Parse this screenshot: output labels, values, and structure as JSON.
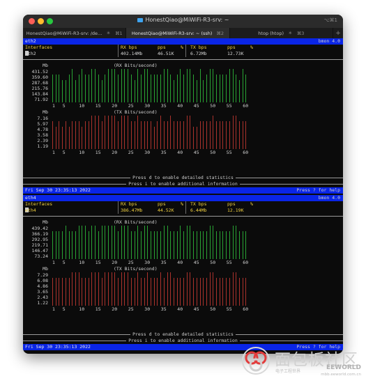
{
  "window": {
    "title": "HonestQiao@MiWiFi-R3-srv: ~",
    "shortcut": "⌥⌘1"
  },
  "tabs": [
    {
      "label": "HonestQiao@MiWiFi-R3-srv: /de...",
      "shortcut": "⌘1",
      "active": false
    },
    {
      "label": "HonestQiao@MiWiFi-R3-srv: ~ (ssh)",
      "shortcut": "⌘2",
      "active": true
    },
    {
      "label": "htop (htop)",
      "shortcut": "⌘3",
      "active": false
    }
  ],
  "new_tab": "+",
  "panes": [
    {
      "iface": "eth2",
      "version": "bmon 4.0",
      "cols": {
        "interfaces": "Interfaces",
        "rx_bps": "RX bps",
        "pps": "pps",
        "pct": "%",
        "tx_bps": "TX bps",
        "tx_pps": "pps",
        "tx_pct": "%"
      },
      "row": {
        "name": "eth2",
        "rx_bps": "402.14Mb",
        "rx_pps": "46.51K",
        "tx_bps": "6.72Mb",
        "tx_pps": "12.73K"
      },
      "row_highlight": false,
      "rx_graph": {
        "title": "(RX Bits/second)",
        "unit": "Mb",
        "labels": [
          "431.52",
          "359.60",
          "287.68",
          "215.76",
          "143.84",
          "71.92"
        ],
        "heights": [
          5,
          5,
          5,
          4,
          4,
          5,
          6,
          4,
          5,
          6,
          5,
          5,
          6,
          6,
          5,
          4,
          5,
          6,
          6,
          6,
          5,
          6,
          6,
          6,
          5,
          4,
          6,
          5,
          6,
          6,
          5,
          5,
          5,
          5,
          6,
          6,
          5,
          4,
          5,
          6,
          5,
          6,
          6,
          5,
          4,
          6,
          4,
          5,
          6,
          6,
          5,
          5,
          5,
          5,
          6,
          6,
          5,
          4,
          6,
          5
        ]
      },
      "tx_graph": {
        "title": "(TX Bits/second)",
        "unit": "Mb",
        "labels": [
          "7.16",
          "5.97",
          "4.78",
          "3.58",
          "2.39",
          "1.19"
        ],
        "heights": [
          5,
          4,
          5,
          4,
          5,
          4,
          5,
          5,
          5,
          4,
          5,
          5,
          6,
          6,
          6,
          5,
          6,
          6,
          6,
          6,
          5,
          6,
          6,
          6,
          5,
          5,
          6,
          5,
          5,
          5,
          5,
          4,
          5,
          6,
          5,
          5,
          6,
          5,
          5,
          5,
          5,
          6,
          6,
          4,
          4,
          5,
          5,
          5,
          5,
          6,
          5,
          5,
          5,
          5,
          5,
          6,
          6,
          5,
          5,
          5
        ]
      },
      "xaxis": [
        "1",
        "5",
        "10",
        "15",
        "20",
        "25",
        "30",
        "35",
        "40",
        "45",
        "50",
        "55",
        "60"
      ],
      "notice1": "Press d to enable detailed statistics",
      "notice2": "Press i to enable additional information",
      "status_left": "Fri Sep 30 23:35:13 2022",
      "status_right": "Press ? for help"
    },
    {
      "iface": "eth4",
      "version": "bmon 4.0",
      "cols": {
        "interfaces": "Interfaces",
        "rx_bps": "RX bps",
        "pps": "pps",
        "pct": "%",
        "tx_bps": "TX bps",
        "tx_pps": "pps",
        "tx_pct": "%"
      },
      "row": {
        "name": "eth4",
        "rx_bps": "386.47Mb",
        "rx_pps": "44.52K",
        "tx_bps": "6.44Mb",
        "tx_pps": "12.19K"
      },
      "row_highlight": true,
      "rx_graph": {
        "title": "(RX Bits/second)",
        "unit": "Mb",
        "labels": [
          "439.42",
          "366.19",
          "292.95",
          "219.71",
          "146.47",
          "73.24"
        ],
        "heights": [
          5,
          5,
          5,
          5,
          6,
          5,
          5,
          5,
          6,
          6,
          6,
          5,
          6,
          6,
          5,
          6,
          6,
          6,
          6,
          6,
          5,
          6,
          6,
          6,
          5,
          5,
          6,
          5,
          6,
          6,
          5,
          5,
          5,
          5,
          6,
          6,
          5,
          5,
          5,
          6,
          5,
          6,
          6,
          5,
          5,
          5,
          5,
          5,
          6,
          6,
          5,
          5,
          5,
          5,
          5,
          6,
          6,
          5,
          5,
          5
        ]
      },
      "tx_graph": {
        "title": "(TX Bits/second)",
        "unit": "Mb",
        "labels": [
          "7.29",
          "6.08",
          "4.86",
          "3.65",
          "2.43",
          "1.22"
        ],
        "heights": [
          5,
          5,
          5,
          5,
          5,
          5,
          6,
          6,
          6,
          5,
          5,
          5,
          6,
          6,
          6,
          5,
          6,
          6,
          6,
          6,
          5,
          6,
          6,
          6,
          5,
          5,
          6,
          5,
          5,
          6,
          5,
          5,
          5,
          6,
          5,
          6,
          6,
          5,
          5,
          5,
          5,
          6,
          6,
          5,
          5,
          5,
          5,
          5,
          6,
          6,
          5,
          5,
          5,
          5,
          5,
          6,
          6,
          5,
          5,
          5
        ]
      },
      "xaxis": [
        "1",
        "5",
        "10",
        "15",
        "20",
        "25",
        "30",
        "35",
        "40",
        "45",
        "50",
        "55",
        "60"
      ],
      "notice1": "Press d to enable detailed statistics",
      "notice2": "Press i to enable additional information",
      "status_left": "Fri Sep 30 23:35:13 2022",
      "status_right": "Press ? for help"
    }
  ],
  "colors": {
    "rx": "#2fbf3c",
    "tx": "#c83a32",
    "header": "#0a25e6",
    "accent": "#f4d340"
  },
  "watermark": {
    "cn": "面包板社区",
    "small": "电子工程世界",
    "brand": "EEWORLD",
    "url": "mbb.eeworld.com.cn"
  }
}
